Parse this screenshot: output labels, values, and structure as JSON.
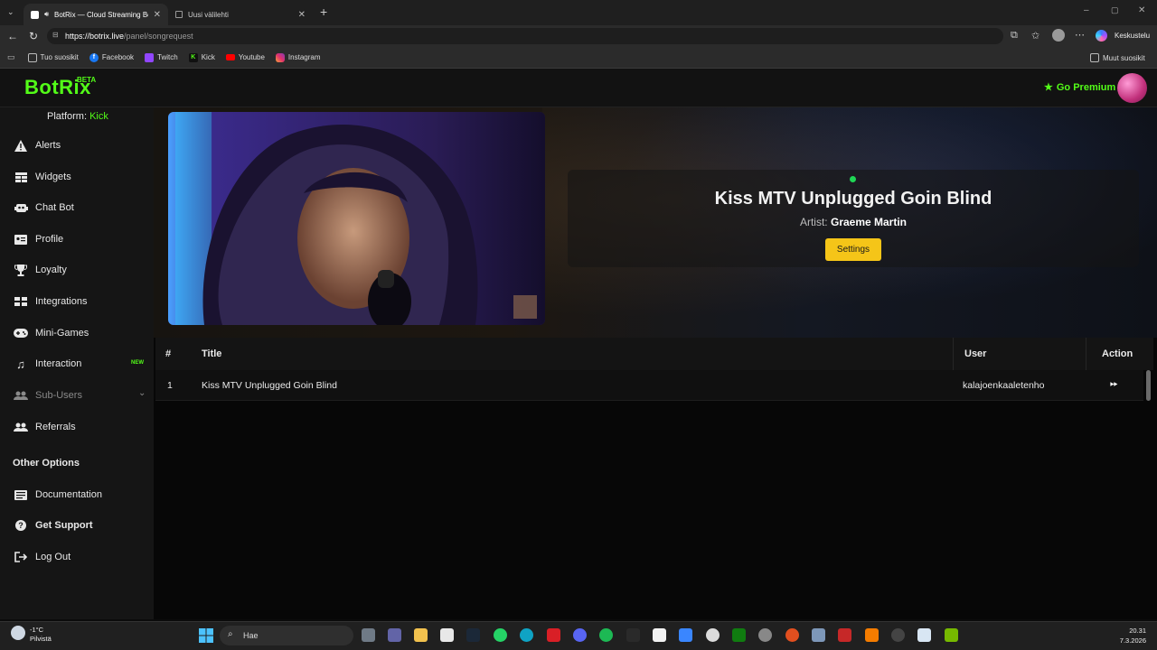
{
  "browser": {
    "tabs": [
      {
        "title": "BotRix — Cloud Streaming Bot",
        "active": true
      },
      {
        "title": "Uusi välilehti",
        "active": false
      }
    ],
    "address": {
      "host": "https://botrix.live",
      "path": "/panel/songrequest"
    },
    "profile_label": "Keskustelu",
    "bookmarks": [
      {
        "label": "Tuo suosikit",
        "icon": "import-icon"
      },
      {
        "label": "Facebook",
        "icon": "facebook-icon",
        "color": "#1877f2"
      },
      {
        "label": "Twitch",
        "icon": "twitch-icon",
        "color": "#9146ff"
      },
      {
        "label": "Kick",
        "icon": "kick-icon",
        "color": "#53fc18"
      },
      {
        "label": "Youtube",
        "icon": "youtube-icon",
        "color": "#ff0000"
      },
      {
        "label": "Instagram",
        "icon": "instagram-icon",
        "color": "#e1306c"
      }
    ],
    "other_bookmarks": "Muut suosikit"
  },
  "app": {
    "logo": "BotRix",
    "logo_badge": "BETA",
    "premium_label": "Go Premium",
    "accent_color": "#53fc18",
    "platform_label": "Platform:",
    "platform_value": "Kick"
  },
  "sidebar": {
    "items": [
      {
        "label": "Alerts",
        "icon": "warning-icon"
      },
      {
        "label": "Widgets",
        "icon": "grid-icon"
      },
      {
        "label": "Chat Bot",
        "icon": "robot-icon"
      },
      {
        "label": "Profile",
        "icon": "id-card-icon"
      },
      {
        "label": "Loyalty",
        "icon": "trophy-icon"
      },
      {
        "label": "Integrations",
        "icon": "puzzle-icon"
      },
      {
        "label": "Mini-Games",
        "icon": "gamepad-icon"
      },
      {
        "label": "Interaction",
        "icon": "music-icon",
        "badge": "NEW"
      },
      {
        "label": "Sub-Users",
        "icon": "users-icon"
      },
      {
        "label": "Referrals",
        "icon": "user-group-icon"
      }
    ],
    "other_heading": "Other Options",
    "other_items": [
      {
        "label": "Documentation",
        "icon": "book-icon"
      },
      {
        "label": "Get Support",
        "icon": "question-icon"
      },
      {
        "label": "Log Out",
        "icon": "logout-icon"
      }
    ]
  },
  "player": {
    "song_title": "Kiss MTV Unplugged Goin Blind",
    "artist_label": "Artist:",
    "artist_name": "Graeme Martin",
    "settings_label": "Settings"
  },
  "queue": {
    "columns": [
      "#",
      "Title",
      "User",
      "Action"
    ],
    "rows": [
      {
        "num": "1",
        "title": "Kiss MTV Unplugged Goin Blind",
        "user": "kalajoenkaaletenho",
        "action": "skip-icon"
      }
    ]
  },
  "taskbar": {
    "weather_temp": "-1°C",
    "weather_desc": "Pilvistä",
    "search_placeholder": "Hae",
    "time": "20.31",
    "date": "7.3.2026"
  }
}
